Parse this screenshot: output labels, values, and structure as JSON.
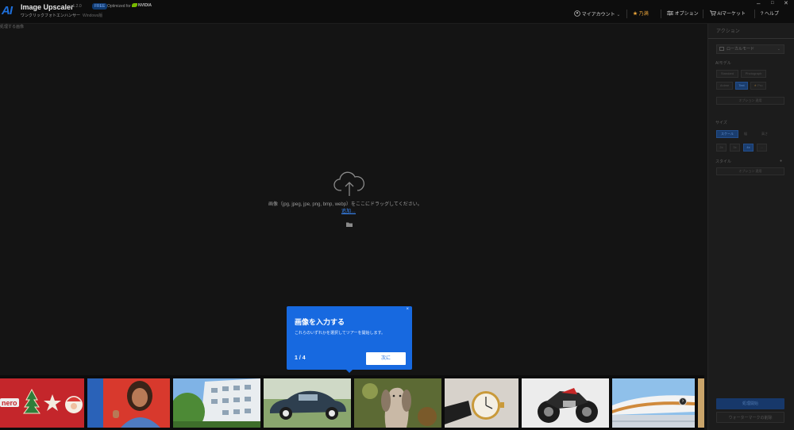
{
  "titlebar": {
    "logo": "AI",
    "app_title": "Image Upscaler",
    "version": "v1.2.0",
    "free_badge": "FREE",
    "optimized_for": "Optimized for",
    "nvidia": "NVIDIA",
    "subtitle": "ワンクリックフォトエンハンサー",
    "edition": "Windows版",
    "nav": {
      "account": "マイアカウント",
      "upgrade": "乃满",
      "options": "オプション",
      "market": "AIマーケット",
      "help": "ヘルプ"
    },
    "window": {
      "minimize": "–",
      "maximize": "□",
      "close": "✕"
    }
  },
  "main": {
    "header": "処理する画像",
    "drop_text": "画像（jpg, jpeg, jpe, png, bmp, webp）をここにドラッグしてください。",
    "browse_link": "追加…",
    "icons": {
      "upload": "cloud-upload-icon",
      "folder": "folder-icon"
    }
  },
  "tour": {
    "close": "×",
    "title": "画像を入力する",
    "body": "これらのいずれかを選択してツアーを開始します。",
    "step": "1 / 4",
    "next_label": "次に"
  },
  "thumbnails": [
    {
      "name": "thumb-christmas-cookies"
    },
    {
      "name": "thumb-smiling-woman"
    },
    {
      "name": "thumb-building"
    },
    {
      "name": "thumb-vintage-car"
    },
    {
      "name": "thumb-dog"
    },
    {
      "name": "thumb-wristwatch"
    },
    {
      "name": "thumb-motorcycle"
    },
    {
      "name": "thumb-architecture"
    }
  ],
  "panel": {
    "tab": "アクション",
    "mode": "ローカルモード",
    "ai_model_label": "AIモデル",
    "model_buttons": [
      "Standard",
      "Photograph",
      "Anime",
      "Text",
      "Pro"
    ],
    "model_selected": "Text",
    "extra_button": "オプション 適用",
    "size_label": "サイズ",
    "size_tabs": [
      "スケール",
      "幅",
      "高さ"
    ],
    "size_selected": "スケール",
    "scale_buttons": [
      "2x",
      "3x",
      "4x",
      "..."
    ],
    "scale_selected": "4x",
    "style_label": "スタイル",
    "style_button": "オプション 適用",
    "start_button": "処理開始",
    "watermark_button": "ウォーターマークの削除"
  },
  "colors": {
    "accent": "#1769e0",
    "upgrade": "#e8a33a"
  }
}
